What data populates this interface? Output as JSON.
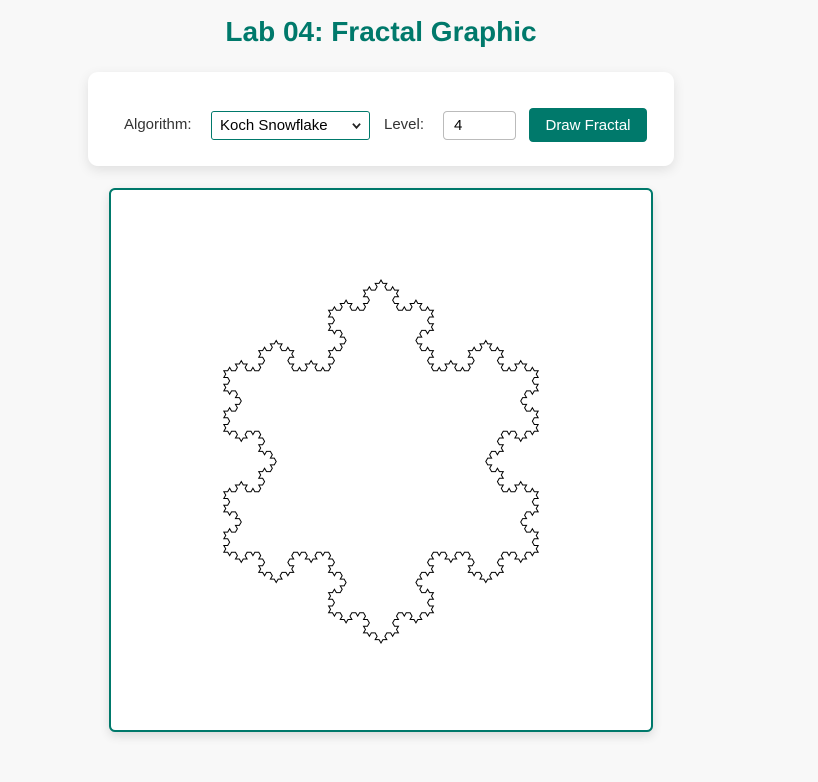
{
  "page": {
    "title": "Lab 04: Fractal Graphic"
  },
  "controls": {
    "algorithm_label": "Algorithm:",
    "algorithm_selected": "Koch Snowflake",
    "level_label": "Level:",
    "level_value": "4",
    "draw_button_label": "Draw Fractal"
  },
  "fractal": {
    "algorithm": "koch-snowflake",
    "level": 4,
    "stroke_color": "#000000"
  },
  "colors": {
    "accent": "#00796b",
    "background": "#f8f8f8",
    "card": "#ffffff"
  }
}
